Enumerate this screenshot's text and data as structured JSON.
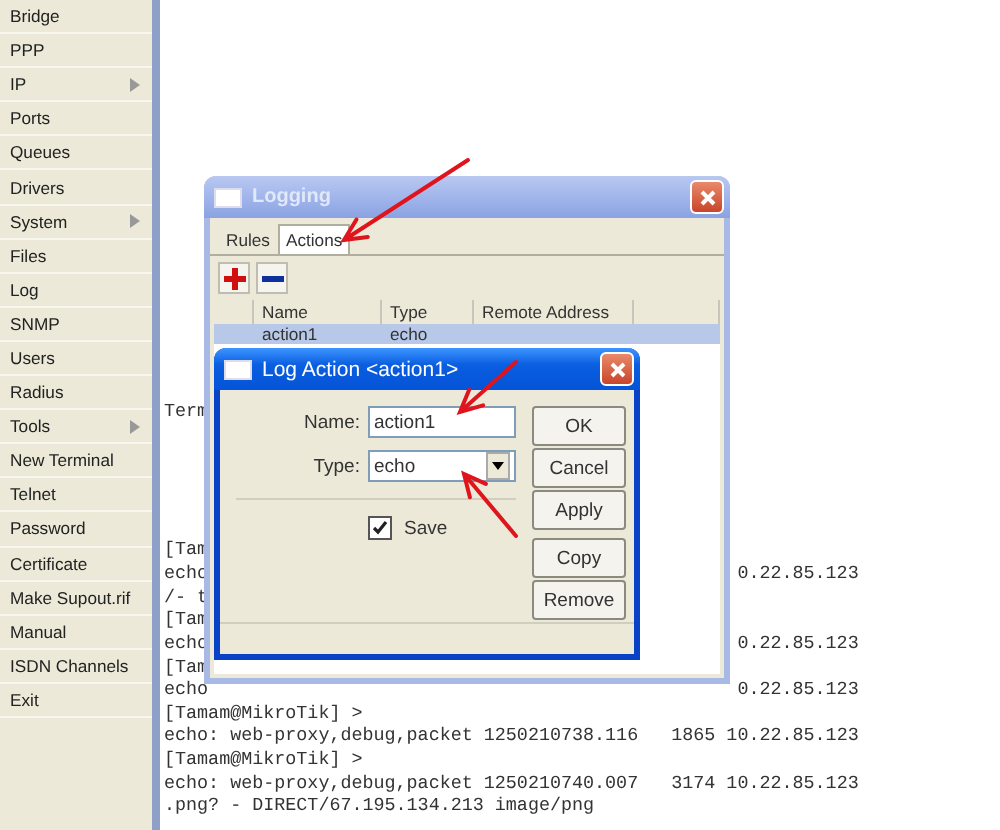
{
  "sidebar": {
    "items": [
      {
        "label": "Bridge",
        "submenu": false
      },
      {
        "label": "PPP",
        "submenu": false
      },
      {
        "label": "IP",
        "submenu": true
      },
      {
        "label": "Ports",
        "submenu": false
      },
      {
        "label": "Queues",
        "submenu": false
      },
      {
        "label": "Drivers",
        "submenu": false
      },
      {
        "label": "System",
        "submenu": true
      },
      {
        "label": "Files",
        "submenu": false
      },
      {
        "label": "Log",
        "submenu": false
      },
      {
        "label": "SNMP",
        "submenu": false
      },
      {
        "label": "Users",
        "submenu": false
      },
      {
        "label": "Radius",
        "submenu": false
      },
      {
        "label": "Tools",
        "submenu": true
      },
      {
        "label": "New Terminal",
        "submenu": false
      },
      {
        "label": "Telnet",
        "submenu": false
      },
      {
        "label": "Password",
        "submenu": false
      },
      {
        "label": "Certificate",
        "submenu": false
      },
      {
        "label": "Make Supout.rif",
        "submenu": false
      },
      {
        "label": "Manual",
        "submenu": false
      },
      {
        "label": "ISDN Channels",
        "submenu": false
      },
      {
        "label": "Exit",
        "submenu": false
      }
    ]
  },
  "terminal": {
    "blocks": [
      {
        "lines": [
          {
            "text": "Term"
          }
        ]
      },
      {
        "lines": [
          {
            "text": "[Tam"
          },
          {
            "text": "echo",
            "tail": "0.22.85.123"
          },
          {
            "text": "/- t"
          },
          {
            "text": "[Tam"
          },
          {
            "text": "echo",
            "tail": "0.22.85.123"
          },
          {
            "text": "[Tam"
          },
          {
            "text": "echo",
            "tail": "0.22.85.123"
          },
          {
            "text": "[Tamam@MikroTik] >"
          },
          {
            "text": "echo: web-proxy,debug,packet 1250210738.116   1865 10.22.85.123"
          },
          {
            "text": "[Tamam@MikroTik] >"
          },
          {
            "text": "echo: web-proxy,debug,packet 1250210740.007   3174 10.22.85.123"
          },
          {
            "text": ".png? - DIRECT/67.195.134.213 image/png"
          }
        ]
      }
    ]
  },
  "logging_window": {
    "title": "Logging",
    "active": false,
    "tabs": [
      {
        "label": "Rules",
        "selected": false
      },
      {
        "label": "Actions",
        "selected": true
      }
    ],
    "table": {
      "columns": [
        "Name",
        "Type",
        "Remote Address"
      ],
      "rows": [
        {
          "cells": [
            "action1",
            "echo"
          ],
          "selected": true
        }
      ]
    }
  },
  "dialog": {
    "title": "Log Action <action1>",
    "active": true,
    "fields": [
      {
        "label": "Name:",
        "kind": "text",
        "value": "action1"
      },
      {
        "label": "Type:",
        "kind": "dropdown",
        "value": "echo"
      }
    ],
    "save": {
      "label": "Save",
      "checked": true
    },
    "buttons": [
      "OK",
      "Cancel",
      "Apply",
      "Copy",
      "Remove"
    ]
  }
}
